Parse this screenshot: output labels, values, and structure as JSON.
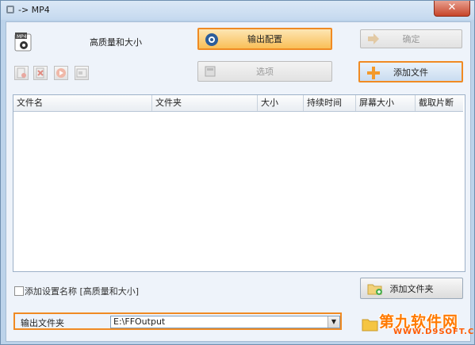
{
  "window": {
    "title": "-> MP4"
  },
  "profile": {
    "icon_label": "MP4",
    "name": "高质量和大小"
  },
  "buttons": {
    "output_config": "输出配置",
    "ok": "确定",
    "options": "选项",
    "add_file": "添加文件",
    "add_folder": "添加文件夹"
  },
  "table": {
    "columns": [
      "文件名",
      "文件夹",
      "大小",
      "持续时间",
      "屏幕大小",
      "截取片断"
    ],
    "rows": []
  },
  "checkbox": {
    "label": "添加设置名称 [高质量和大小]",
    "checked": false
  },
  "output": {
    "label": "输出文件夹",
    "value": "E:\\FFOutput"
  },
  "watermark": {
    "brand": "第九软件网",
    "url": "WWW.D9SOFT.COM"
  },
  "colors": {
    "highlight": "#f08a22",
    "client_bg": "#eef3fa"
  }
}
